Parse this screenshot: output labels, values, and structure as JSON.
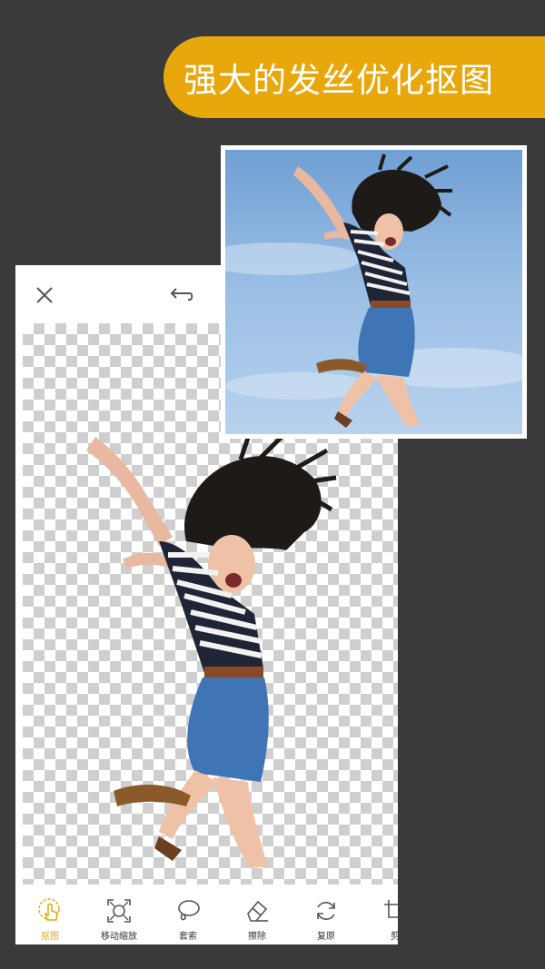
{
  "banner": {
    "title": "强大的发丝优化抠图"
  },
  "app": {
    "toolbar": [
      {
        "label": "抠图",
        "icon": "hand-tap-icon",
        "active": true
      },
      {
        "label": "移动缩放",
        "icon": "move-zoom-icon",
        "active": false
      },
      {
        "label": "套索",
        "icon": "lasso-icon",
        "active": false
      },
      {
        "label": "擦除",
        "icon": "eraser-icon",
        "active": false
      },
      {
        "label": "复原",
        "icon": "restore-icon",
        "active": false
      },
      {
        "label": "剪",
        "icon": "crop-icon",
        "active": false
      }
    ]
  },
  "colors": {
    "accent": "#e8a80c",
    "background": "#3a3a3a"
  }
}
